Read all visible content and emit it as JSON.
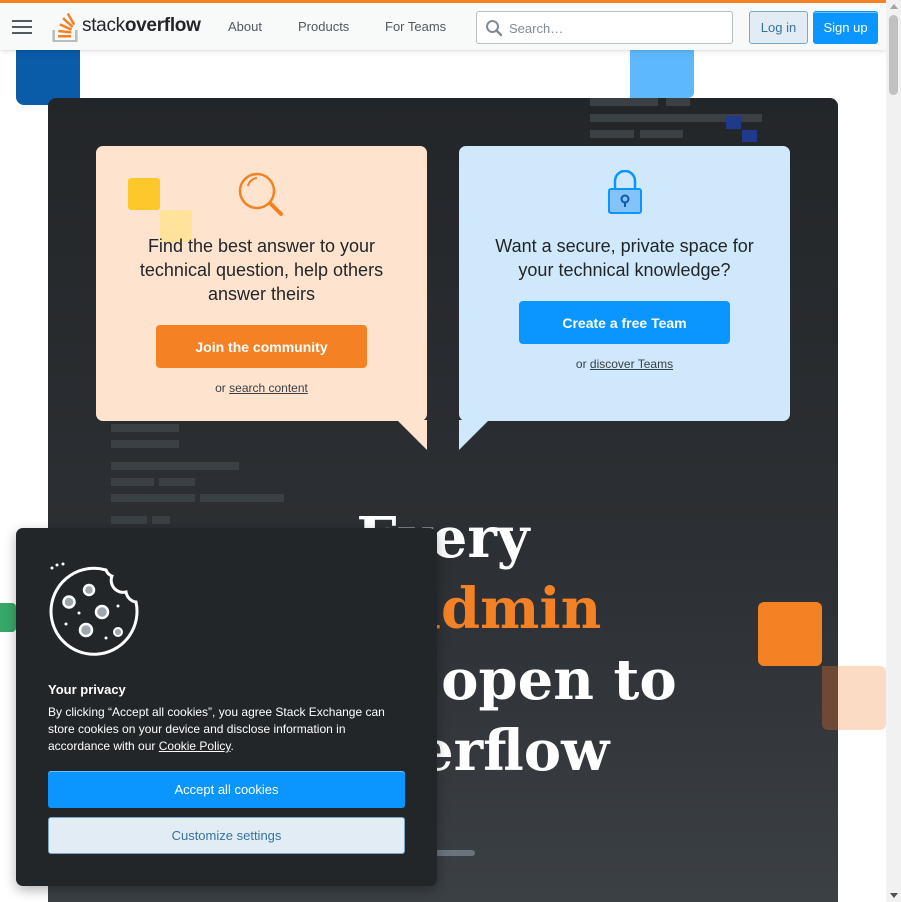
{
  "header": {
    "logo_prefix": "stack",
    "logo_suffix": "overflow",
    "nav": [
      "About",
      "Products",
      "For Teams"
    ],
    "search_placeholder": "Search…",
    "login_label": "Log in",
    "signup_label": "Sign up"
  },
  "cards": {
    "community": {
      "text": "Find the best answer to your technical question, help others answer theirs",
      "button": "Join the community",
      "sub_prefix": "or",
      "sub_link": "search content"
    },
    "teams": {
      "text": "Want a secure, private space for your technical knowledge?",
      "button": "Create a free Team",
      "sub_prefix": "or",
      "sub_link": "discover Teams"
    }
  },
  "hero": {
    "line1": "Every",
    "line2": "admin",
    "line3": "o open to",
    "line4": "Overflow"
  },
  "cookie": {
    "title": "Your privacy",
    "text": "By clicking “Accept all cookies”, you agree Stack Exchange can store cookies on your device and disclose information in accordance with our",
    "policy_link": "Cookie Policy",
    "policy_suffix": ".",
    "accept_label": "Accept all cookies",
    "customize_label": "Customize settings"
  },
  "colors": {
    "brand_orange": "#f48225",
    "brand_blue": "#0a95ff",
    "hero_bg": "#232629"
  }
}
